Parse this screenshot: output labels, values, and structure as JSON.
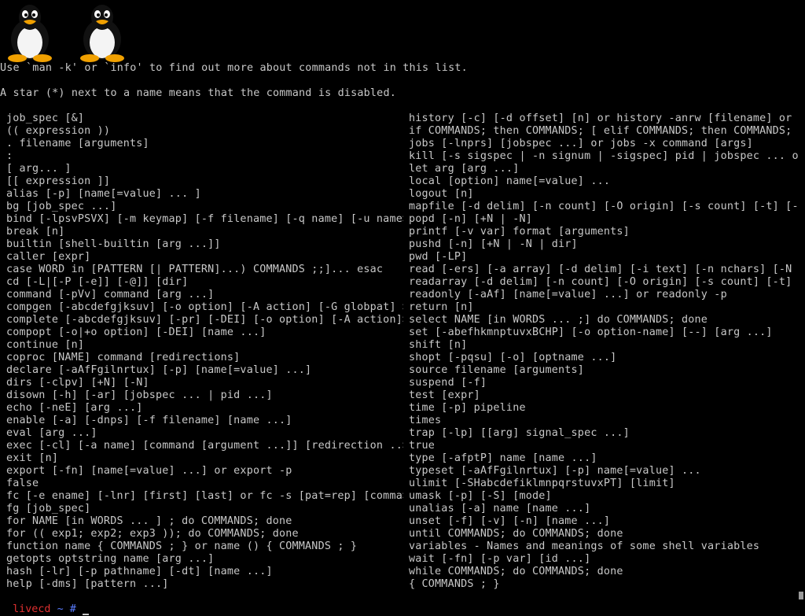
{
  "logos": [
    "tux-icon",
    "tux-icon"
  ],
  "intro": {
    "line1": "Use `man -k' or `info' to find out more about commands not in this list.",
    "line2": "A star (*) next to a name means that the command is disabled."
  },
  "commands_left": [
    "job_spec [&]",
    "(( expression ))",
    ". filename [arguments]",
    ":",
    "[ arg... ]",
    "[[ expression ]]",
    "alias [-p] [name[=value] ... ]",
    "bg [job_spec ...]",
    "bind [-lpsvPSVX] [-m keymap] [-f filename] [-q name] [-u name>",
    "break [n]",
    "builtin [shell-builtin [arg ...]]",
    "caller [expr]",
    "case WORD in [PATTERN [| PATTERN]...) COMMANDS ;;]... esac",
    "cd [-L|[-P [-e]] [-@]] [dir]",
    "command [-pVv] command [arg ...]",
    "compgen [-abcdefgjksuv] [-o option] [-A action] [-G globpat] >",
    "complete [-abcdefgjksuv] [-pr] [-DEI] [-o option] [-A action]>",
    "compopt [-o|+o option] [-DEI] [name ...]",
    "continue [n]",
    "coproc [NAME] command [redirections]",
    "declare [-aAfFgilnrtux] [-p] [name[=value] ...]",
    "dirs [-clpv] [+N] [-N]",
    "disown [-h] [-ar] [jobspec ... | pid ...]",
    "echo [-neE] [arg ...]",
    "enable [-a] [-dnps] [-f filename] [name ...]",
    "eval [arg ...]",
    "exec [-cl] [-a name] [command [argument ...]] [redirection ..>",
    "exit [n]",
    "export [-fn] [name[=value] ...] or export -p",
    "false",
    "fc [-e ename] [-lnr] [first] [last] or fc -s [pat=rep] [comma>",
    "fg [job_spec]",
    "for NAME [in WORDS ... ] ; do COMMANDS; done",
    "for (( exp1; exp2; exp3 )); do COMMANDS; done",
    "function name { COMMANDS ; } or name () { COMMANDS ; }",
    "getopts optstring name [arg ...]",
    "hash [-lr] [-p pathname] [-dt] [name ...]",
    "help [-dms] [pattern ...]"
  ],
  "commands_right": [
    "history [-c] [-d offset] [n] or history -anrw [filename] or >",
    "if COMMANDS; then COMMANDS; [ elif COMMANDS; then COMMANDS; >",
    "jobs [-lnprs] [jobspec ...] or jobs -x command [args]",
    "kill [-s sigspec | -n signum | -sigspec] pid | jobspec ... o>",
    "let arg [arg ...]",
    "local [option] name[=value] ...",
    "logout [n]",
    "mapfile [-d delim] [-n count] [-O origin] [-s count] [-t] [->",
    "popd [-n] [+N | -N]",
    "printf [-v var] format [arguments]",
    "pushd [-n] [+N | -N | dir]",
    "pwd [-LP]",
    "read [-ers] [-a array] [-d delim] [-i text] [-n nchars] [-N >",
    "readarray [-d delim] [-n count] [-O origin] [-s count] [-t] >",
    "readonly [-aAf] [name[=value] ...] or readonly -p",
    "return [n]",
    "select NAME [in WORDS ... ;] do COMMANDS; done",
    "set [-abefhkmnptuvxBCHP] [-o option-name] [--] [arg ...]",
    "shift [n]",
    "shopt [-pqsu] [-o] [optname ...]",
    "source filename [arguments]",
    "suspend [-f]",
    "test [expr]",
    "time [-p] pipeline",
    "times",
    "trap [-lp] [[arg] signal_spec ...]",
    "true",
    "type [-afptP] name [name ...]",
    "typeset [-aAfFgilnrtux] [-p] name[=value] ...",
    "ulimit [-SHabcdefiklmnpqrstuvxPT] [limit]",
    "umask [-p] [-S] [mode]",
    "unalias [-a] name [name ...]",
    "unset [-f] [-v] [-n] [name ...]",
    "until COMMANDS; do COMMANDS; done",
    "variables - Names and meanings of some shell variables",
    "wait [-fn] [-p var] [id ...]",
    "while COMMANDS; do COMMANDS; done",
    "{ COMMANDS ; }"
  ],
  "prompt": {
    "host": "livecd",
    "dir": "~",
    "symbol": "#"
  },
  "colors": {
    "background": "#000000",
    "text": "#c8c8c8",
    "host": "#e03030",
    "path": "#5a7dff"
  }
}
